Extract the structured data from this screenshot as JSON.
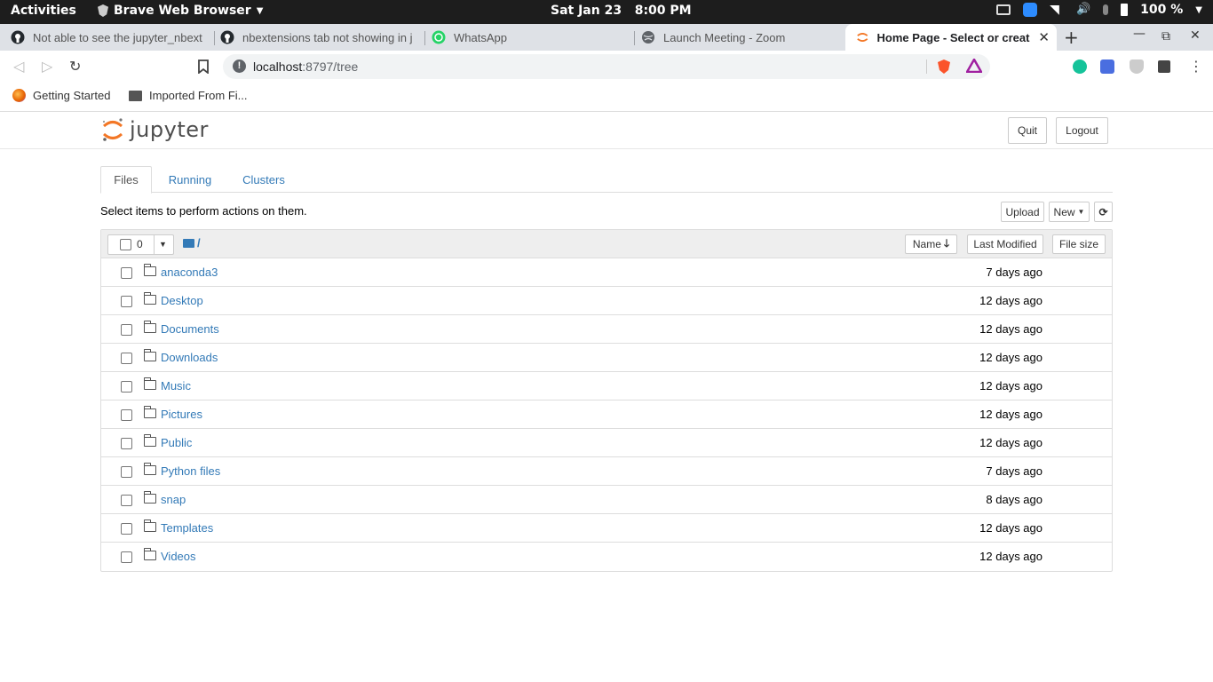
{
  "system_bar": {
    "activities": "Activities",
    "app_name": "Brave Web Browser",
    "clock": "Sat Jan 23   8:00 PM",
    "battery": "100 %"
  },
  "browser": {
    "tabs": [
      {
        "label": "Not able to see the jupyter_nbext",
        "icon": "github-icon"
      },
      {
        "label": "nbextensions tab not showing in j",
        "icon": "github-icon"
      },
      {
        "label": "WhatsApp",
        "icon": "whatsapp-icon"
      },
      {
        "label": "Launch Meeting - Zoom",
        "icon": "globe-icon"
      },
      {
        "label": "Home Page - Select or create a",
        "icon": "jupyter-icon",
        "active": true
      }
    ],
    "address": {
      "host": "localhost",
      "rest": ":8797/tree"
    },
    "bookmarks": [
      {
        "label": "Getting Started",
        "icon": "firefox-icon"
      },
      {
        "label": "Imported From Fi...",
        "icon": "folder-icon"
      }
    ]
  },
  "jupyter": {
    "logo_text": "jupyter",
    "quit_label": "Quit",
    "logout_label": "Logout",
    "tabs": [
      "Files",
      "Running",
      "Clusters"
    ],
    "hint": "Select items to perform actions on them.",
    "upload_label": "Upload",
    "new_label": "New",
    "selected_count": "0",
    "path": "/",
    "columns": {
      "name": "Name",
      "modified": "Last Modified",
      "size": "File size"
    },
    "files": [
      {
        "name": "anaconda3",
        "modified": "7 days ago"
      },
      {
        "name": "Desktop",
        "modified": "12 days ago"
      },
      {
        "name": "Documents",
        "modified": "12 days ago"
      },
      {
        "name": "Downloads",
        "modified": "12 days ago"
      },
      {
        "name": "Music",
        "modified": "12 days ago"
      },
      {
        "name": "Pictures",
        "modified": "12 days ago"
      },
      {
        "name": "Public",
        "modified": "12 days ago"
      },
      {
        "name": "Python files",
        "modified": "7 days ago"
      },
      {
        "name": "snap",
        "modified": "8 days ago"
      },
      {
        "name": "Templates",
        "modified": "12 days ago"
      },
      {
        "name": "Videos",
        "modified": "12 days ago"
      }
    ]
  },
  "colors": {
    "link": "#337ab7",
    "jupyter_orange": "#f37726",
    "topbar": "#1d1d1d",
    "tabstrip": "#dee1e6"
  }
}
